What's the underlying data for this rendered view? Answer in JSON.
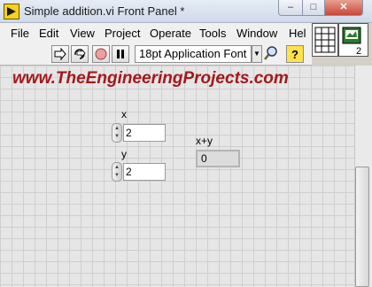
{
  "window": {
    "title": "Simple addition.vi Front Panel *",
    "buttons": {
      "minimize": "–",
      "maximize": "□",
      "close": "✕"
    }
  },
  "menubar": {
    "items": [
      "File",
      "Edit",
      "View",
      "Project",
      "Operate",
      "Tools",
      "Window",
      "Hel"
    ]
  },
  "toolbar": {
    "font_select": "18pt Application Font",
    "icons": [
      "run-arrow-icon",
      "run-continuously-icon",
      "abort-icon",
      "pause-icon",
      "font-dropdown-arrow-icon",
      "search-icon",
      "help-icon"
    ]
  },
  "vi_icon": {
    "count": "2"
  },
  "watermark": "www.TheEngineeringProjects.com",
  "controls": {
    "x": {
      "label": "x",
      "value": "2"
    },
    "y": {
      "label": "y",
      "value": "2"
    }
  },
  "indicator": {
    "label": "x+y",
    "value": "0"
  },
  "colors": {
    "watermark": "#a3191b",
    "panel_bg": "#e6e6e6",
    "grid": "#cfcfcf"
  }
}
